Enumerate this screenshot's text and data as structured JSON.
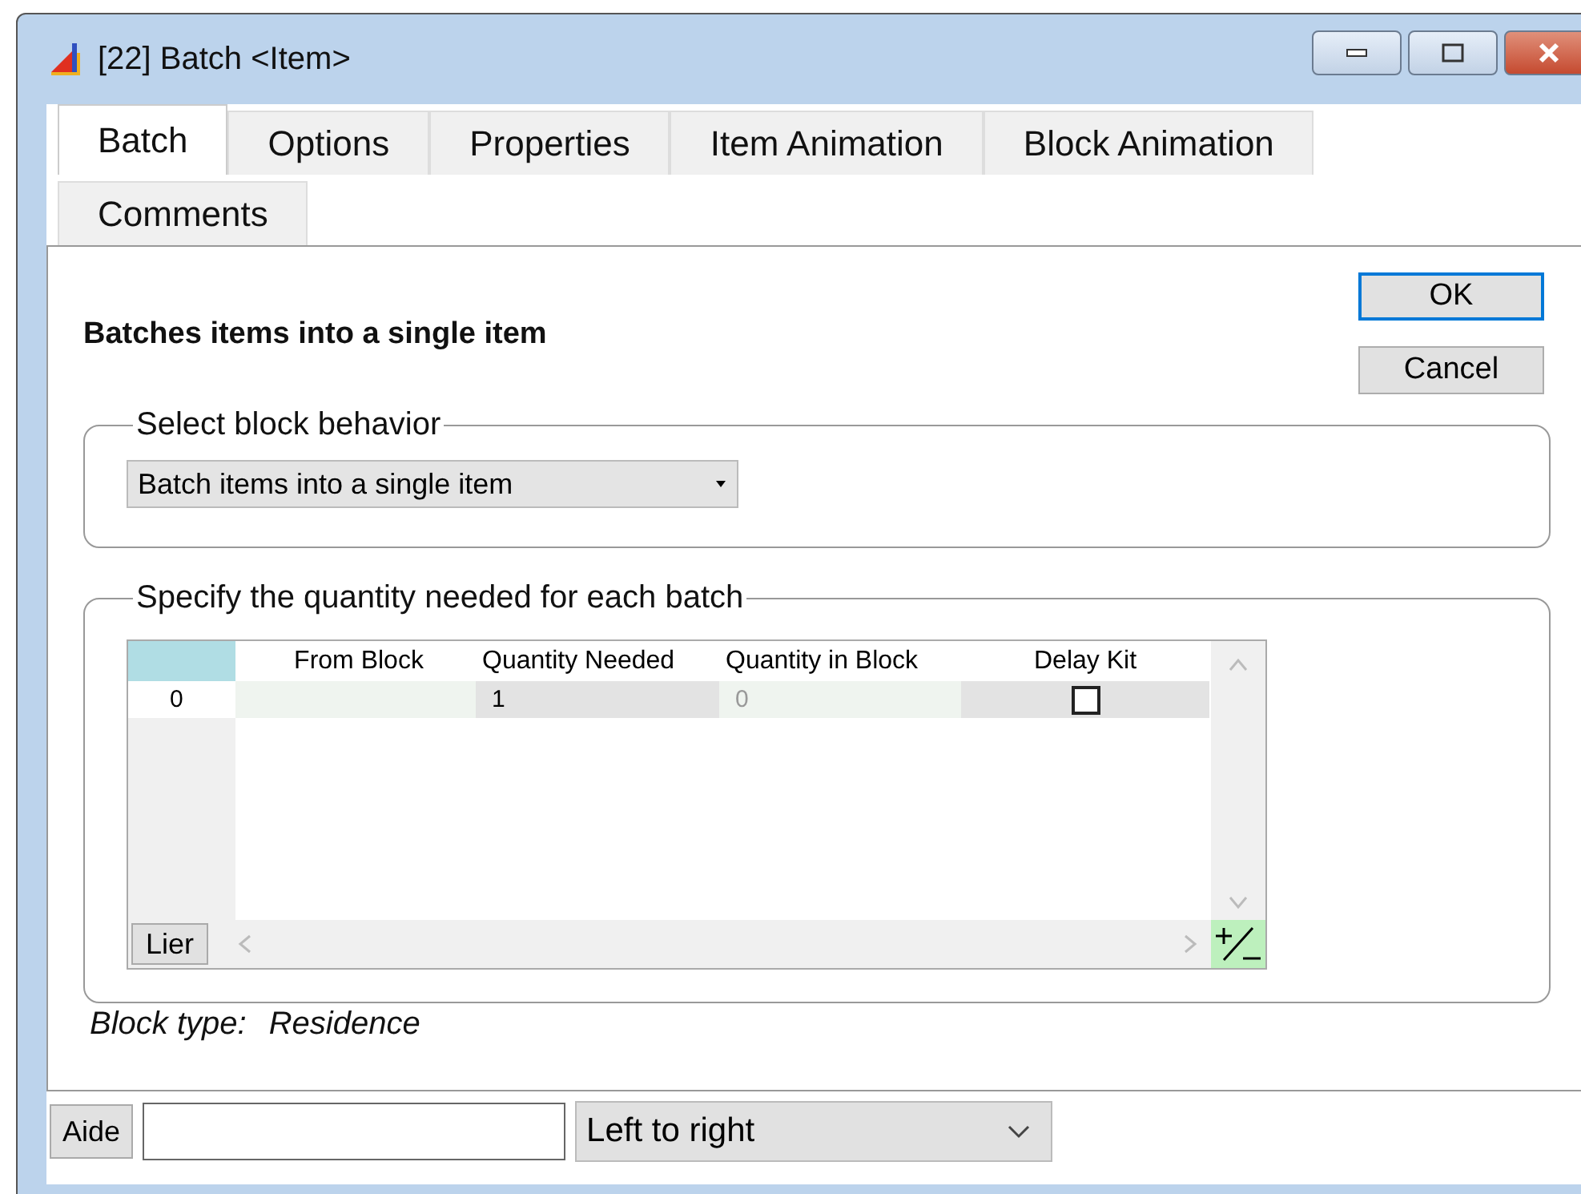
{
  "window": {
    "title": "[22] Batch <Item>"
  },
  "tab_rows": [
    [
      {
        "label": "Batch",
        "selected": true
      },
      {
        "label": "Options",
        "selected": false
      },
      {
        "label": "Properties",
        "selected": false
      },
      {
        "label": "Item Animation",
        "selected": false
      },
      {
        "label": "Block Animation",
        "selected": false
      }
    ],
    [
      {
        "label": "Comments",
        "selected": false
      }
    ]
  ],
  "heading": "Batches items into a single item",
  "buttons": [
    {
      "label": "OK",
      "default": true
    },
    {
      "label": "Cancel",
      "default": false
    }
  ],
  "behavior_group": {
    "legend": "Select block behavior",
    "dropdown": {
      "value": "Batch items into a single item"
    }
  },
  "quantity_group": {
    "legend": "Specify the quantity needed for each batch",
    "table": {
      "columns": [
        "From Block",
        "Quantity Needed",
        "Quantity in Block",
        "Delay Kit"
      ],
      "rows": [
        {
          "index": "0",
          "quantity_needed": "1",
          "quantity_in_block": "0",
          "delay_kit": false
        }
      ],
      "link_button": "Lier"
    }
  },
  "block_type": {
    "label": "Block type:",
    "value": "Residence"
  },
  "footer": {
    "help_button": "Aide",
    "direction": {
      "value": "Left to right"
    }
  }
}
